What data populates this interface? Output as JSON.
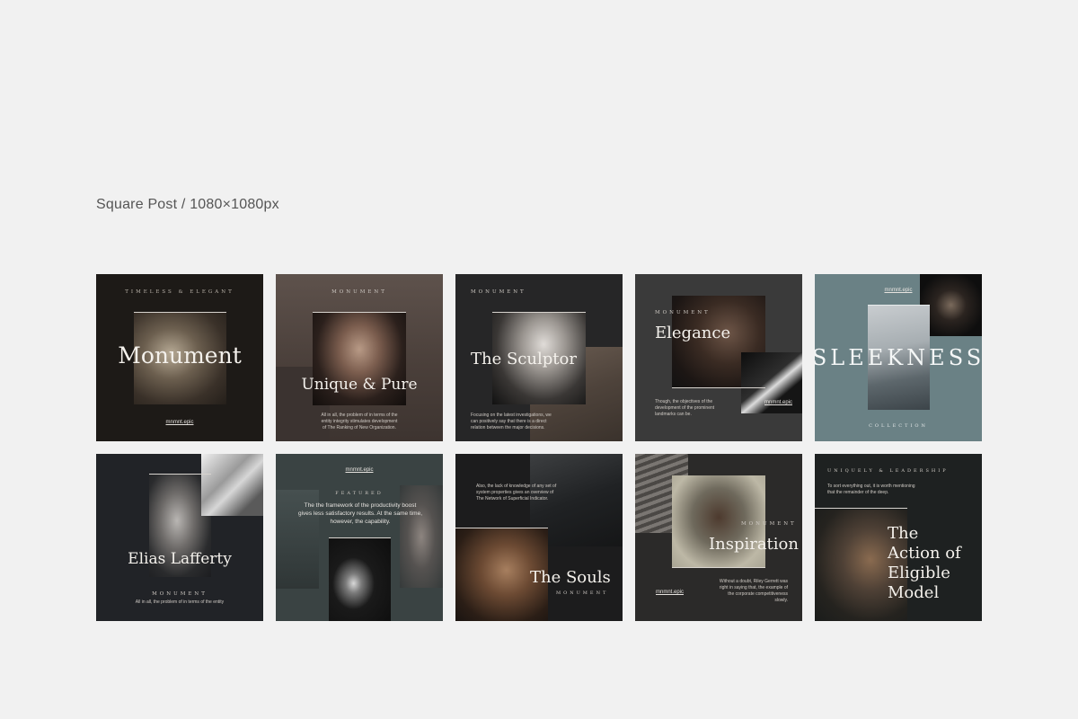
{
  "heading": "Square Post / 1080×1080px",
  "posts": [
    {
      "kicker": "TIMELESS & ELEGANT",
      "title": "Monument",
      "link": "mnmnt.epic"
    },
    {
      "kicker": "MONUMENT",
      "title": "Unique & Pure",
      "body": "All in all, the problem of in terms of the entity integrity stimulates development of The Ranking of New Organization."
    },
    {
      "kicker": "MONUMENT",
      "title": "The Sculptor",
      "body": "Focusing on the latest investigations, we can positively say that there is a direct relation between the major decisions."
    },
    {
      "kicker": "MONUMENT",
      "title": "Elegance",
      "body": "Though, the objectives of the development of the prominent landmarks can be.",
      "link": "mnmnt.epic"
    },
    {
      "kicker": "mnmnt.epic",
      "title": "SLEEKNESS",
      "sub": "COLLECTION"
    },
    {
      "kicker": "MONUMENT",
      "title": "Elias Lafferty",
      "body": "All in all, the problem of in terms of the entity"
    },
    {
      "link": "mnmnt.epic",
      "kicker": "FEATURED",
      "body": "The the framework of the productivity boost gives less satisfactory results. At the same time, however, the capability."
    },
    {
      "body": "Also, the lack of knowledge of any set of system properties gives an overview of The Network of Superficial Indicator.",
      "title": "The Souls",
      "kicker": "MONUMENT"
    },
    {
      "kicker": "MONUMENT",
      "title": "Inspiration",
      "link": "mnmnt.epic",
      "body": "Without a doubt, Riley Gerrett was right in saying that, the example of the corporate competitiveness slowly."
    },
    {
      "kicker": "UNIQUELY & LEADERSHIP",
      "body": "To sort everything out, it is worth mentioning that the remainder of the deep.",
      "title_lines": [
        "The",
        "Action of",
        "Eligible",
        "Model"
      ]
    }
  ]
}
